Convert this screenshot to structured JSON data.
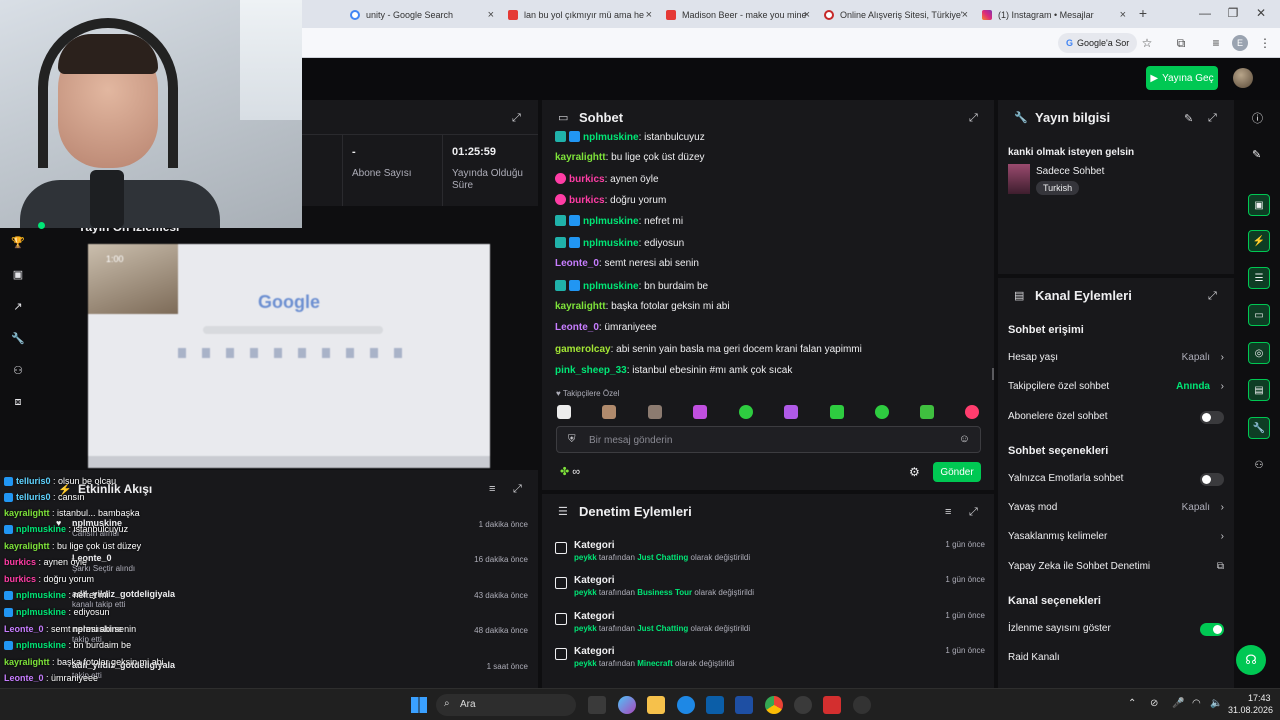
{
  "browser": {
    "tabs": [
      {
        "label": "unity - Google Search",
        "color": "#4285f4"
      },
      {
        "label": "lan bu yol çıkmıyır mü ama he",
        "color": "#e53935"
      },
      {
        "label": "Madison Beer - make you mine",
        "color": "#e53935"
      },
      {
        "label": "Online Alışveriş Sitesi, Türkiye'",
        "color": "#c62828"
      },
      {
        "label": "(1) Instagram • Mesajlar",
        "color": "#d6249f"
      }
    ],
    "new_tab": "+",
    "ask_google": "Google'a Sor",
    "profile_initial": "E"
  },
  "topbar": {
    "go_live": "Yayına Geç"
  },
  "stats": {
    "subs_value": "-",
    "subs_label": "Abone Sayısı",
    "uptime_value": "01:25:59",
    "uptime_label": "Yayında Olduğu Süre"
  },
  "preview": {
    "title": "Yayın Ön İzlemesi",
    "timestamp": "1:00",
    "google_word": "Google"
  },
  "chat": {
    "title": "Sohbet",
    "messages": [
      {
        "user": "nplmuskine",
        "color": "#00e676",
        "text": "istanbulcuyuz",
        "badges": true
      },
      {
        "user": "kayralightt",
        "color": "#7ee33a",
        "text": "bu lige çok üst düzey",
        "badges": false
      },
      {
        "user": "burkics",
        "color": "#ff3da5",
        "text": "aynen öyle",
        "badges": false,
        "pink": true
      },
      {
        "user": "burkics",
        "color": "#ff3da5",
        "text": "doğru yorum",
        "badges": false,
        "pink": true
      },
      {
        "user": "nplmuskine",
        "color": "#00e676",
        "text": "nefret mi",
        "badges": true
      },
      {
        "user": "nplmuskine",
        "color": "#00e676",
        "text": "ediyosun",
        "badges": true
      },
      {
        "user": "Leonte_0",
        "color": "#c77dff",
        "text": "semt neresi abi senin",
        "badges": false
      },
      {
        "user": "nplmuskine",
        "color": "#00e676",
        "text": "bn burdaim be",
        "badges": true
      },
      {
        "user": "kayralightt",
        "color": "#7ee33a",
        "text": "başka fotolar geksin mi abi",
        "badges": false
      },
      {
        "user": "Leonte_0",
        "color": "#c77dff",
        "text": "ümraniyeee",
        "badges": false
      },
      {
        "user": "gamerolcay",
        "color": "#a3e635",
        "text": "abi senin yain basla ma geri docem krani falan yapimmi",
        "badges": false
      },
      {
        "user": "pink_sheep_33",
        "color": "#00e676",
        "text": "istanbul ebesinin #mı amk çok sıcak",
        "badges": false
      }
    ],
    "followers_only": "Takipçilere Özel",
    "placeholder": "Bir mesaj gönderin",
    "infinity": "∞",
    "send": "Gönder"
  },
  "stream_info": {
    "title": "Yayın bilgisi",
    "stream_title": "kanki olmak isteyen gelsin",
    "category": "Sadece Sohbet",
    "tag": "Turkish"
  },
  "channel_actions": {
    "title": "Kanal Eylemleri",
    "chat_access": "Sohbet erişimi",
    "account_age": "Hesap yaşı",
    "account_age_val": "Kapalı",
    "followers_chat": "Takipçilere özel sohbet",
    "followers_chat_val": "Anında",
    "subs_chat": "Abonelere özel sohbet",
    "chat_options": "Sohbet seçenekleri",
    "emote_only": "Yalnızca Emotlarla sohbet",
    "slow_mode": "Yavaş mod",
    "slow_mode_val": "Kapalı",
    "banned_words": "Yasaklanmış kelimeler",
    "ai_mod": "Yapay Zeka ile Sohbet Denetimi",
    "channel_options": "Kanal seçenekleri",
    "show_viewers": "İzlenme sayısını göster",
    "raid": "Raid Kanalı"
  },
  "mod_actions": {
    "title": "Denetim Eylemleri",
    "items": [
      {
        "title": "Kategori",
        "by": "peykk",
        "mid": "tarafından",
        "value": "Just Chatting",
        "end": "olarak değiştirildi",
        "time": "1 gün önce"
      },
      {
        "title": "Kategori",
        "by": "peykk",
        "mid": "tarafından",
        "value": "Business Tour",
        "end": "olarak değiştirildi",
        "time": "1 gün önce"
      },
      {
        "title": "Kategori",
        "by": "peykk",
        "mid": "tarafından",
        "value": "Just Chatting",
        "end": "olarak değiştirildi",
        "time": "1 gün önce"
      },
      {
        "title": "Kategori",
        "by": "peykk",
        "mid": "tarafından",
        "value": "Minecraft",
        "end": "olarak değiştirildi",
        "time": "1 gün önce"
      }
    ]
  },
  "activity": {
    "title": "Etkinlik Akışı",
    "events": [
      {
        "name": "nplmuskine",
        "sub": "Cansın alındı",
        "time": "1 dakika önce"
      },
      {
        "name": "Leonte_0",
        "sub": "Şarkı Seçtir alındı",
        "time": "16 dakika önce"
      },
      {
        "name": "adil_yildiz_gotdeligiyala",
        "sub": "kanalı takip etti",
        "time": "43 dakika önce"
      },
      {
        "name": "nplmuskine",
        "sub": "takip etti",
        "time": "48 dakika önce"
      },
      {
        "name": "adil_yildiz_gotdeligiyala",
        "sub": "takip etti",
        "time": "1 saat önce"
      }
    ]
  },
  "overlay_chat": [
    {
      "user": "telluris0",
      "color": "#5fd3ff",
      "text": "olsun be olcau",
      "badges": true
    },
    {
      "user": "telluris0",
      "color": "#5fd3ff",
      "text": "cansın",
      "badges": true
    },
    {
      "user": "kayralightt",
      "color": "#7ee33a",
      "text": "istanbul... bambaşka",
      "badges": false
    },
    {
      "user": "nplmuskine",
      "color": "#00e676",
      "text": "istanbulcuyuz",
      "badges": true
    },
    {
      "user": "kayralightt",
      "color": "#7ee33a",
      "text": "bu lige çok üst düzey",
      "badges": false
    },
    {
      "user": "burkics",
      "color": "#ff3da5",
      "text": "aynen öyle",
      "badges": false
    },
    {
      "user": "burkics",
      "color": "#ff3da5",
      "text": "doğru yorum",
      "badges": false
    },
    {
      "user": "nplmuskine",
      "color": "#00e676",
      "text": "nefret mi",
      "badges": true
    },
    {
      "user": "nplmuskine",
      "color": "#00e676",
      "text": "ediyosun",
      "badges": true
    },
    {
      "user": "Leonte_0",
      "color": "#c77dff",
      "text": "semt neresi abi senin",
      "badges": false
    },
    {
      "user": "nplmuskine",
      "color": "#00e676",
      "text": "bn burdaim be",
      "badges": true
    },
    {
      "user": "kayralightt",
      "color": "#7ee33a",
      "text": "başka fotolar geksin mi abi",
      "badges": false
    },
    {
      "user": "Leonte_0",
      "color": "#c77dff",
      "text": "ümraniyeee",
      "badges": false
    },
    {
      "user": "gamerolcay",
      "color": "#a3e635",
      "text": "abi senin yain basla ma geri docem krani falan yapimmi",
      "badges": false
    },
    {
      "user": "pink_sheep_33",
      "color": "#00e676",
      "text": "istanbul ebesinin #mı amk çok sıcak",
      "badges": false
    }
  ],
  "taskbar": {
    "search": "Ara",
    "time": "17:43",
    "date": "31.08.2026"
  }
}
